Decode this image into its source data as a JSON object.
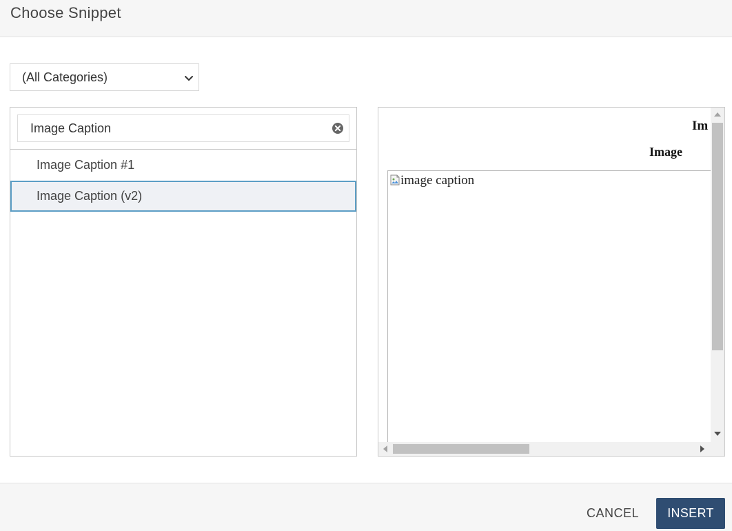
{
  "dialog": {
    "title": "Choose Snippet"
  },
  "category_select": {
    "selected": "(All Categories)"
  },
  "search": {
    "value": "Image Caption"
  },
  "snippets": [
    {
      "label": "Image Caption #1",
      "selected": false
    },
    {
      "label": "Image Caption (v2)",
      "selected": true
    }
  ],
  "preview": {
    "heading_1": "Im",
    "heading_2": "Image",
    "image_alt": "image caption"
  },
  "footer": {
    "cancel_label": "CANCEL",
    "insert_label": "INSERT"
  },
  "icons": {
    "select_chevron": "chevron-down-icon",
    "search_clear": "close-circle-icon",
    "broken_image": "broken-image-icon"
  },
  "colors": {
    "primary_button": "#2f4d72",
    "selected_item_border": "#5c9ec5",
    "selected_item_bg": "#eff1f5"
  }
}
